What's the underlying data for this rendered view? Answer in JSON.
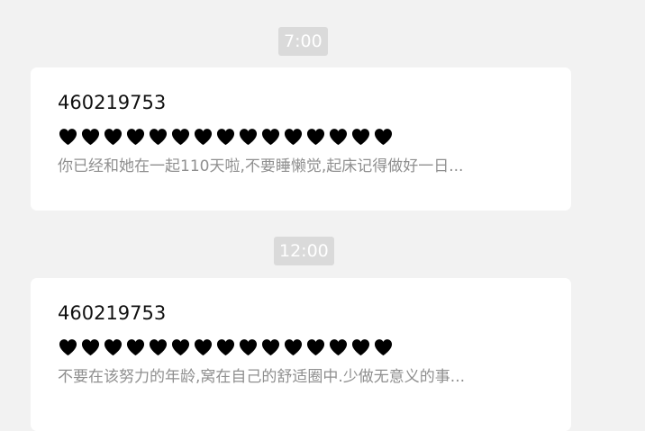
{
  "messages": [
    {
      "time": "7:00",
      "sender": "460219753",
      "heart_count": 15,
      "heart_icon": "black-heart-icon",
      "preview": "你已经和她在一起110天啦,不要睡懒觉,起床记得做好一日..."
    },
    {
      "time": "12:00",
      "sender": "460219753",
      "heart_count": 15,
      "heart_icon": "black-heart-icon",
      "preview": "不要在该努力的年龄,窝在自己的舒适圈中.少做无意义的事..."
    }
  ],
  "colors": {
    "background": "#f2f2f2",
    "badge": "#dadada",
    "card": "#ffffff",
    "preview_text": "#8f8f8f"
  }
}
